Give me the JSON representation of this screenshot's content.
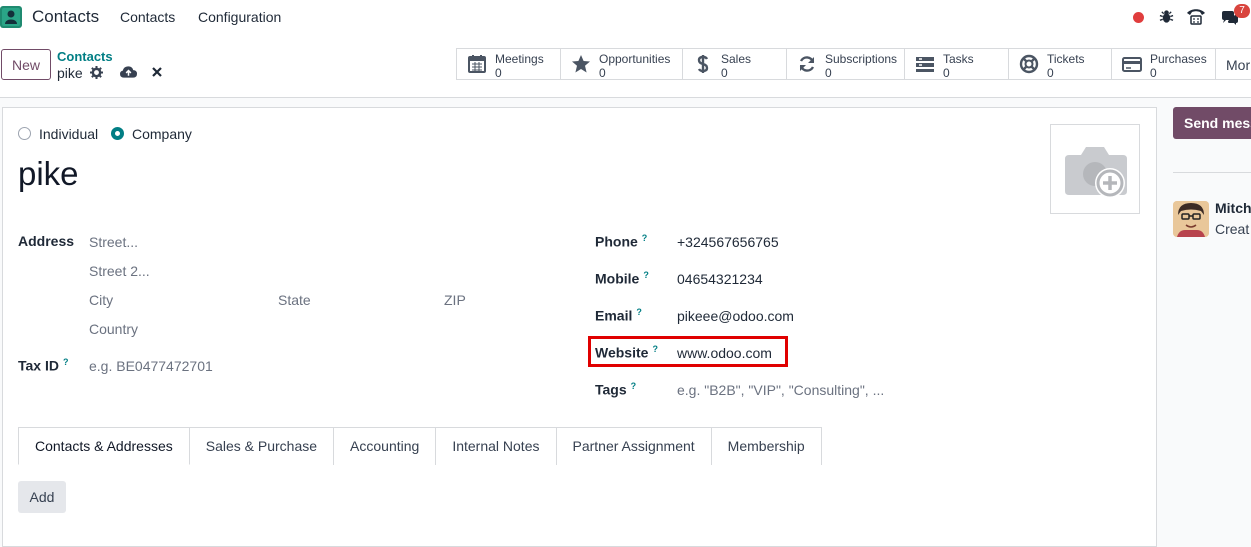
{
  "topbar": {
    "app_name": "Contacts",
    "menu": [
      "Contacts",
      "Configuration"
    ],
    "notification_count": "7"
  },
  "control": {
    "new_label": "New",
    "breadcrumb_parent": "Contacts",
    "breadcrumb_current": "pike",
    "smart_buttons": [
      {
        "label": "Meetings",
        "value": "0",
        "icon": "calendar-icon"
      },
      {
        "label": "Opportunities",
        "value": "0",
        "icon": "star-icon"
      },
      {
        "label": "Sales",
        "value": "0",
        "icon": "dollar-icon"
      },
      {
        "label": "Subscriptions",
        "value": "0",
        "icon": "refresh-icon"
      },
      {
        "label": "Tasks",
        "value": "0",
        "icon": "tasks-icon"
      },
      {
        "label": "Tickets",
        "value": "0",
        "icon": "lifebuoy-icon"
      },
      {
        "label": "Purchases",
        "value": "0",
        "icon": "credit-card-icon"
      }
    ],
    "more_label": "Mor"
  },
  "form": {
    "type_individual": "Individual",
    "type_company": "Company",
    "name": "pike",
    "address_label": "Address",
    "street_placeholder": "Street...",
    "street2_placeholder": "Street 2...",
    "city_placeholder": "City",
    "state_placeholder": "State",
    "zip_placeholder": "ZIP",
    "country_placeholder": "Country",
    "tax_label": "Tax ID",
    "tax_placeholder": "e.g. BE0477472701",
    "phone_label": "Phone",
    "phone_value": "+324567656765",
    "mobile_label": "Mobile",
    "mobile_value": "04654321234",
    "email_label": "Email",
    "email_value": "pikeee@odoo.com",
    "website_label": "Website",
    "website_value": "www.odoo.com",
    "tags_label": "Tags",
    "tags_placeholder": "e.g. \"B2B\", \"VIP\", \"Consulting\", ...",
    "help_mark": "?"
  },
  "tabs": [
    "Contacts & Addresses",
    "Sales & Purchase",
    "Accounting",
    "Internal Notes",
    "Partner Assignment",
    "Membership"
  ],
  "add_label": "Add",
  "chatter": {
    "send_label": "Send mess",
    "author": "Mitch",
    "text": "Creat"
  },
  "colors": {
    "brand": "#714b67",
    "accent": "#017e84",
    "highlight": "#e00000"
  }
}
